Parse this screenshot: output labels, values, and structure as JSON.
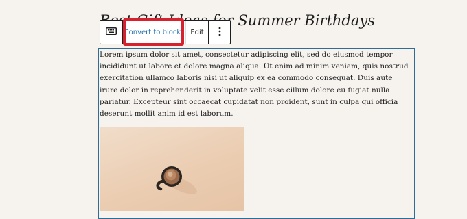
{
  "post": {
    "title": "Best Gift Ideas for Summer Birthdays"
  },
  "toolbar": {
    "keyboard_icon": "keyboard-icon",
    "convert_label": "Convert to blocks",
    "edit_label": "Edit",
    "more_icon": "more-vertical-icon",
    "more_label": "⋮"
  },
  "classic_block": {
    "paragraph": "Lorem ipsum dolor sit amet, consectetur adipiscing elit, sed do eiusmod tempor incididunt ut labore et dolore magna aliqua. Ut enim ad minim veniam, quis nostrud exercitation ullamco laboris nisi ut aliquip ex ea commodo consequat. Duis aute irure dolor in reprehenderit in voluptate velit esse cillum dolore eu fugiat nulla pariatur. Excepteur sint occaecat cupidatat non proident, sunt in culpa qui officia deserunt mollit anim id est laborum."
  },
  "colors": {
    "background": "#f6f2ee",
    "accent_blue": "#2271b1",
    "block_border": "#2e6d95",
    "highlight_red": "#d6212f"
  }
}
